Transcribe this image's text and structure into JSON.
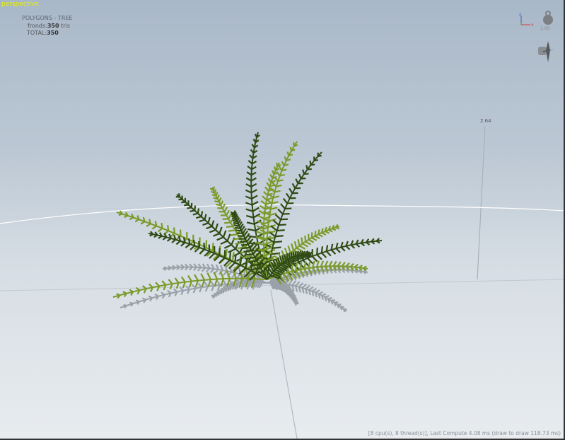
{
  "viewport": {
    "mode_label": "perspective"
  },
  "stats": {
    "title": "POLYGONS - TREE",
    "fronds_label": "fronds:",
    "fronds_value": "350",
    "fronds_unit": " tris",
    "total_label": "TOTAL:",
    "total_value": "350"
  },
  "gizmo": {
    "axis_z": "z",
    "axis_x": "x",
    "scale_value": "1.00"
  },
  "scene": {
    "height_marker": "2.64",
    "colors": {
      "frond_dark": "#2f4a14",
      "frond_light": "#7a9a2a",
      "shadow": "#9aa1a8"
    }
  },
  "status_bar": {
    "text": "[8 cpu(s), 8 thread(s)], Last Compute 4.08 ms (draw to draw 118.73 ms)"
  }
}
